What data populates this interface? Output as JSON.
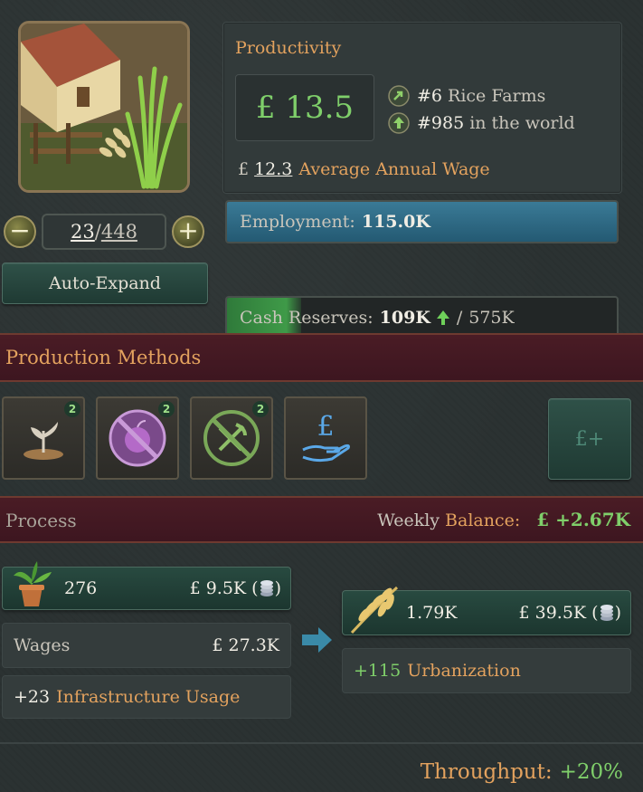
{
  "building": {
    "levels_current": "23",
    "levels_max": "448",
    "auto_expand_label": "Auto-Expand"
  },
  "productivity": {
    "title": "Productivity",
    "value": "£ 13.5",
    "rank_local_num": "#6",
    "rank_local_label": "Rice Farms",
    "rank_world_num": "#985",
    "rank_world_label": "in the world",
    "wage_symbol": "£",
    "wage_value": "12.3",
    "wage_label": "Average Annual Wage"
  },
  "employment": {
    "label": "Employment:",
    "value": "115.0K",
    "fill_fraction": 1.0
  },
  "cash": {
    "label": "Cash Reserves:",
    "value": "109K",
    "separator": "/",
    "max": "575K",
    "fill_fraction": 0.19
  },
  "production_methods": {
    "title": "Production Methods",
    "items": [
      {
        "icon": "sprout-icon",
        "badge": "2"
      },
      {
        "icon": "no-fruit-icon",
        "badge": "2"
      },
      {
        "icon": "no-tools-icon",
        "badge": "2"
      },
      {
        "icon": "pound-hand-icon",
        "badge": ""
      }
    ],
    "subsidy_label": "£+"
  },
  "process": {
    "title": "Process",
    "balance_word1": "Weekly",
    "balance_word2": "Balance:",
    "balance_value": "£ +2.67K"
  },
  "inputs": {
    "good_qty": "276",
    "good_value": "£ 9.5K (",
    "good_paren_close": ")",
    "wages_label": "Wages",
    "wages_value": "£ 27.3K",
    "infra_value": "+23",
    "infra_label": "Infrastructure Usage"
  },
  "outputs": {
    "good_qty": "1.79K",
    "good_value": "£ 39.5K (",
    "good_paren_close": ")",
    "urban_value": "+115",
    "urban_label": "Urbanization"
  },
  "throughput": {
    "label": "Throughput:",
    "value": "+20%"
  },
  "colors": {
    "gold": "#e3a25e",
    "green": "#7fcf6a",
    "banner": "#4a1c25",
    "employment_bar": "#2f6a86"
  }
}
